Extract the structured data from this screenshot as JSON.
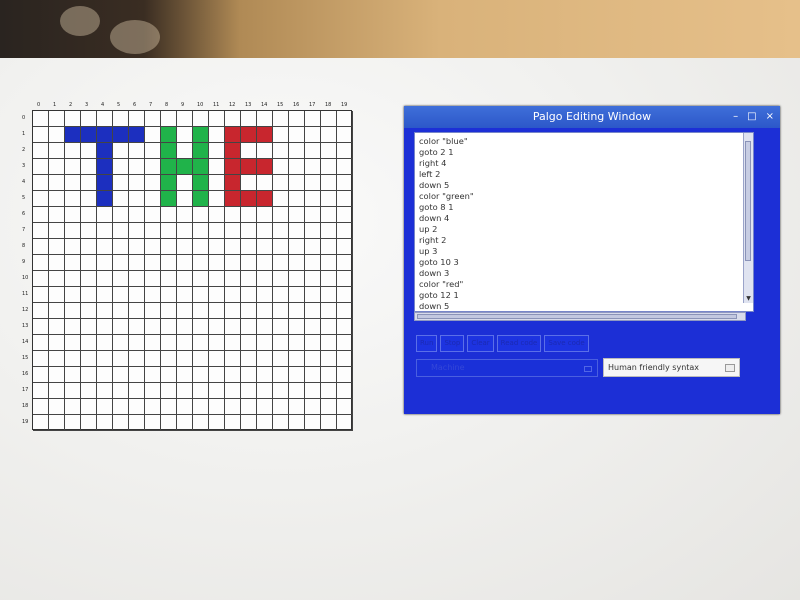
{
  "grid": {
    "columns": 20,
    "rows": 20,
    "col_labels": [
      "0",
      "1",
      "2",
      "3",
      "4",
      "5",
      "6",
      "7",
      "8",
      "9",
      "10",
      "11",
      "12",
      "13",
      "14",
      "15",
      "16",
      "17",
      "18",
      "19"
    ],
    "row_labels": [
      "0",
      "1",
      "2",
      "3",
      "4",
      "5",
      "6",
      "7",
      "8",
      "9",
      "10",
      "11",
      "12",
      "13",
      "14",
      "15",
      "16",
      "17",
      "18",
      "19"
    ],
    "colors": {
      "blue": "#1c2fbf",
      "green": "#20b34a",
      "red": "#c8262e"
    },
    "painted_cells": [
      {
        "x": 2,
        "y": 1,
        "color": "blue"
      },
      {
        "x": 3,
        "y": 1,
        "color": "blue"
      },
      {
        "x": 4,
        "y": 1,
        "color": "blue"
      },
      {
        "x": 5,
        "y": 1,
        "color": "blue"
      },
      {
        "x": 6,
        "y": 1,
        "color": "blue"
      },
      {
        "x": 4,
        "y": 2,
        "color": "blue"
      },
      {
        "x": 4,
        "y": 3,
        "color": "blue"
      },
      {
        "x": 4,
        "y": 4,
        "color": "blue"
      },
      {
        "x": 4,
        "y": 5,
        "color": "blue"
      },
      {
        "x": 8,
        "y": 1,
        "color": "green"
      },
      {
        "x": 8,
        "y": 2,
        "color": "green"
      },
      {
        "x": 8,
        "y": 3,
        "color": "green"
      },
      {
        "x": 8,
        "y": 4,
        "color": "green"
      },
      {
        "x": 8,
        "y": 5,
        "color": "green"
      },
      {
        "x": 9,
        "y": 3,
        "color": "green"
      },
      {
        "x": 10,
        "y": 1,
        "color": "green"
      },
      {
        "x": 10,
        "y": 2,
        "color": "green"
      },
      {
        "x": 10,
        "y": 3,
        "color": "green"
      },
      {
        "x": 10,
        "y": 4,
        "color": "green"
      },
      {
        "x": 10,
        "y": 5,
        "color": "green"
      },
      {
        "x": 12,
        "y": 1,
        "color": "red"
      },
      {
        "x": 12,
        "y": 2,
        "color": "red"
      },
      {
        "x": 12,
        "y": 3,
        "color": "red"
      },
      {
        "x": 12,
        "y": 4,
        "color": "red"
      },
      {
        "x": 12,
        "y": 5,
        "color": "red"
      },
      {
        "x": 13,
        "y": 1,
        "color": "red"
      },
      {
        "x": 14,
        "y": 1,
        "color": "red"
      },
      {
        "x": 13,
        "y": 3,
        "color": "red"
      },
      {
        "x": 14,
        "y": 3,
        "color": "red"
      },
      {
        "x": 13,
        "y": 5,
        "color": "red"
      },
      {
        "x": 14,
        "y": 5,
        "color": "red"
      }
    ]
  },
  "window": {
    "title": "Palgo Editing Window",
    "minimize": "–",
    "maximize": "□",
    "close": "×",
    "code_lines": [
      "color \"blue\"",
      "goto 2 1",
      "right 4",
      "left 2",
      "down 5",
      "color \"green\"",
      "goto 8 1",
      "down 4",
      "up 2",
      "right 2",
      "up 3",
      "goto 10 3",
      "down 3",
      "color \"red\"",
      "goto 12 1",
      "down 5"
    ],
    "buttons": [
      "Run",
      "Stop",
      "Clear",
      "Read code",
      "Save code"
    ],
    "mode_select": "Machine",
    "syntax_select": "Human friendly syntax"
  }
}
